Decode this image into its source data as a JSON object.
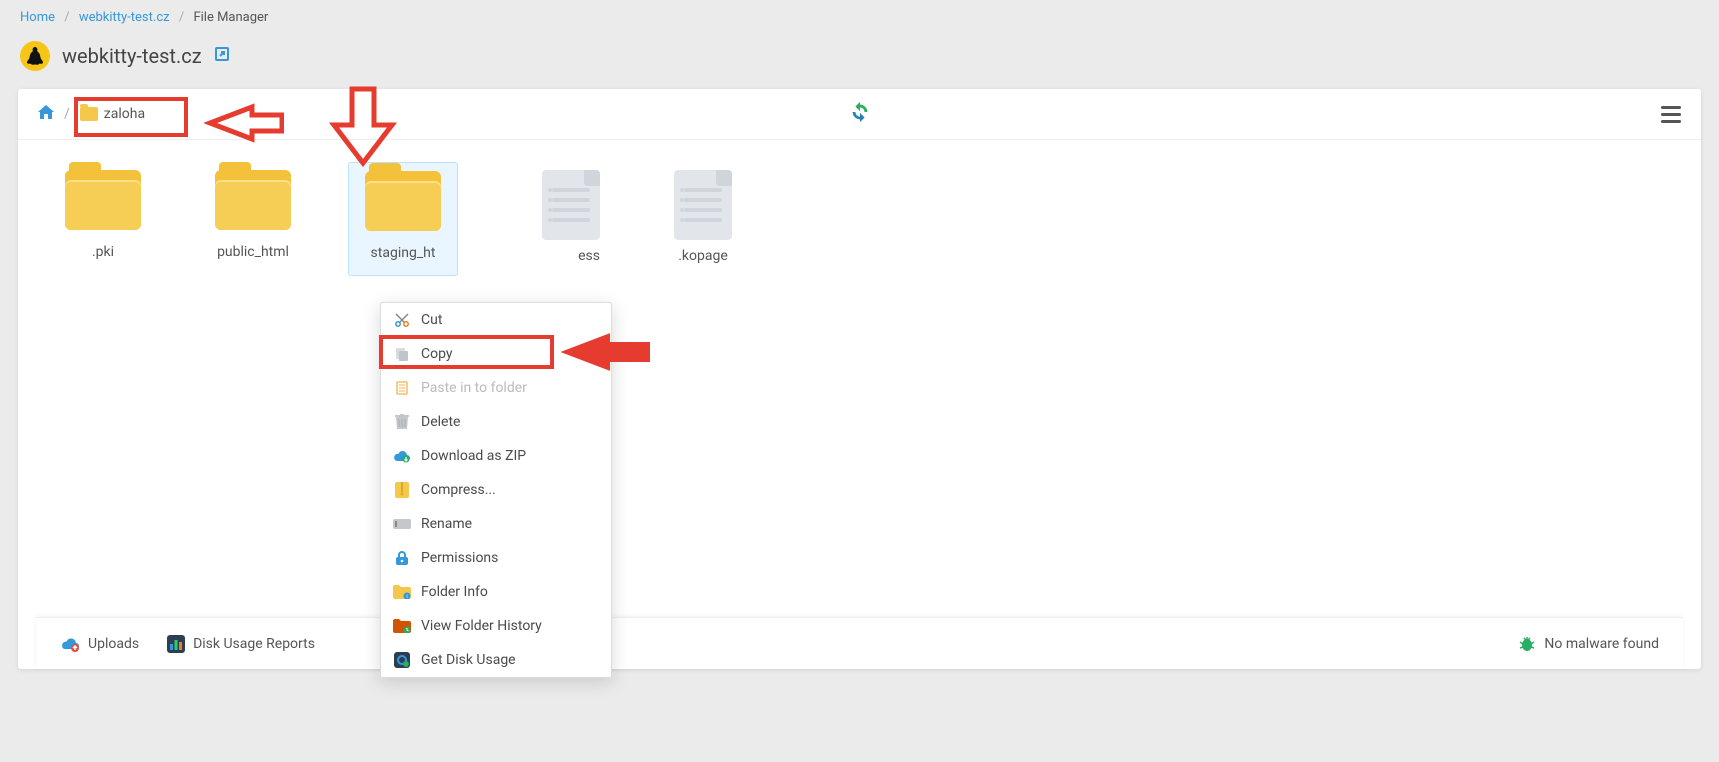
{
  "breadcrumb": {
    "home": "Home",
    "domain": "webkitty-test.cz",
    "current": "File Manager"
  },
  "page_title": "webkitty-test.cz",
  "path_crumb": {
    "folder_name": "zaloha"
  },
  "files": [
    {
      "name": ".pki",
      "type": "folder"
    },
    {
      "name": "public_html",
      "type": "folder"
    },
    {
      "name": "staging_ht",
      "type": "folder",
      "selected": true
    },
    {
      "name": "ess",
      "type": "file",
      "obscured": true
    },
    {
      "name": ".kopage",
      "type": "file"
    }
  ],
  "context_menu": {
    "cut": "Cut",
    "copy": "Copy",
    "paste": "Paste in to folder",
    "delete": "Delete",
    "download_zip": "Download as ZIP",
    "compress": "Compress...",
    "rename": "Rename",
    "permissions": "Permissions",
    "folder_info": "Folder Info",
    "view_history": "View Folder History",
    "disk_usage": "Get Disk Usage"
  },
  "bottom": {
    "uploads": "Uploads",
    "disk_reports": "Disk Usage Reports",
    "malware": "No malware found"
  }
}
